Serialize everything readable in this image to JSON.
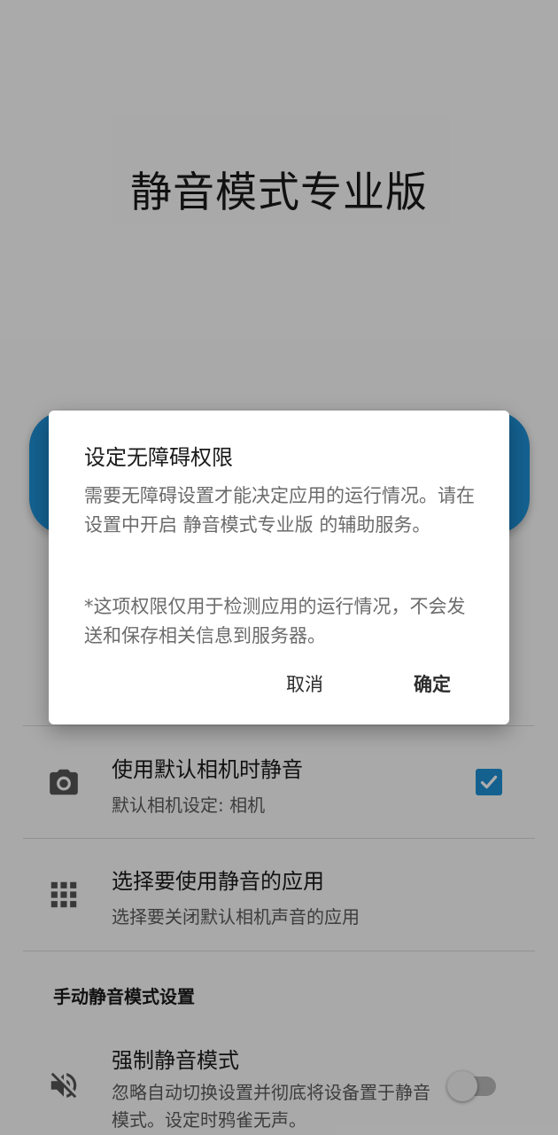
{
  "app": {
    "title": "静音模式专业版"
  },
  "settings": {
    "camera_row": {
      "icon": "camera-icon",
      "title": "使用默认相机时静音",
      "subtitle": "默认相机设定: 相机",
      "checked": true
    },
    "apps_row": {
      "icon": "apps-grid-icon",
      "title": "选择要使用静音的应用",
      "subtitle": "选择要关闭默认相机声音的应用"
    },
    "manual_section": {
      "header": "手动静音模式设置"
    },
    "force_silent_row": {
      "icon": "volume-off-icon",
      "title": "强制静音模式",
      "subtitle": "忽略自动切换设置并彻底将设备置于静音模式。设定时鸦雀无声。",
      "enabled": false
    }
  },
  "dialog": {
    "title": "设定无障碍权限",
    "message": "需要无障碍设置才能决定应用的运行情况。请在设置中开启 静音模式专业版 的辅助服务。",
    "note": "*这项权限仅用于检测应用的运行情况，不会发送和保存相关信息到服务器。",
    "cancel_label": "取消",
    "ok_label": "确定"
  },
  "colors": {
    "accent": "#1e8fd5",
    "scrim": "rgba(0,0,0,0.32)"
  }
}
